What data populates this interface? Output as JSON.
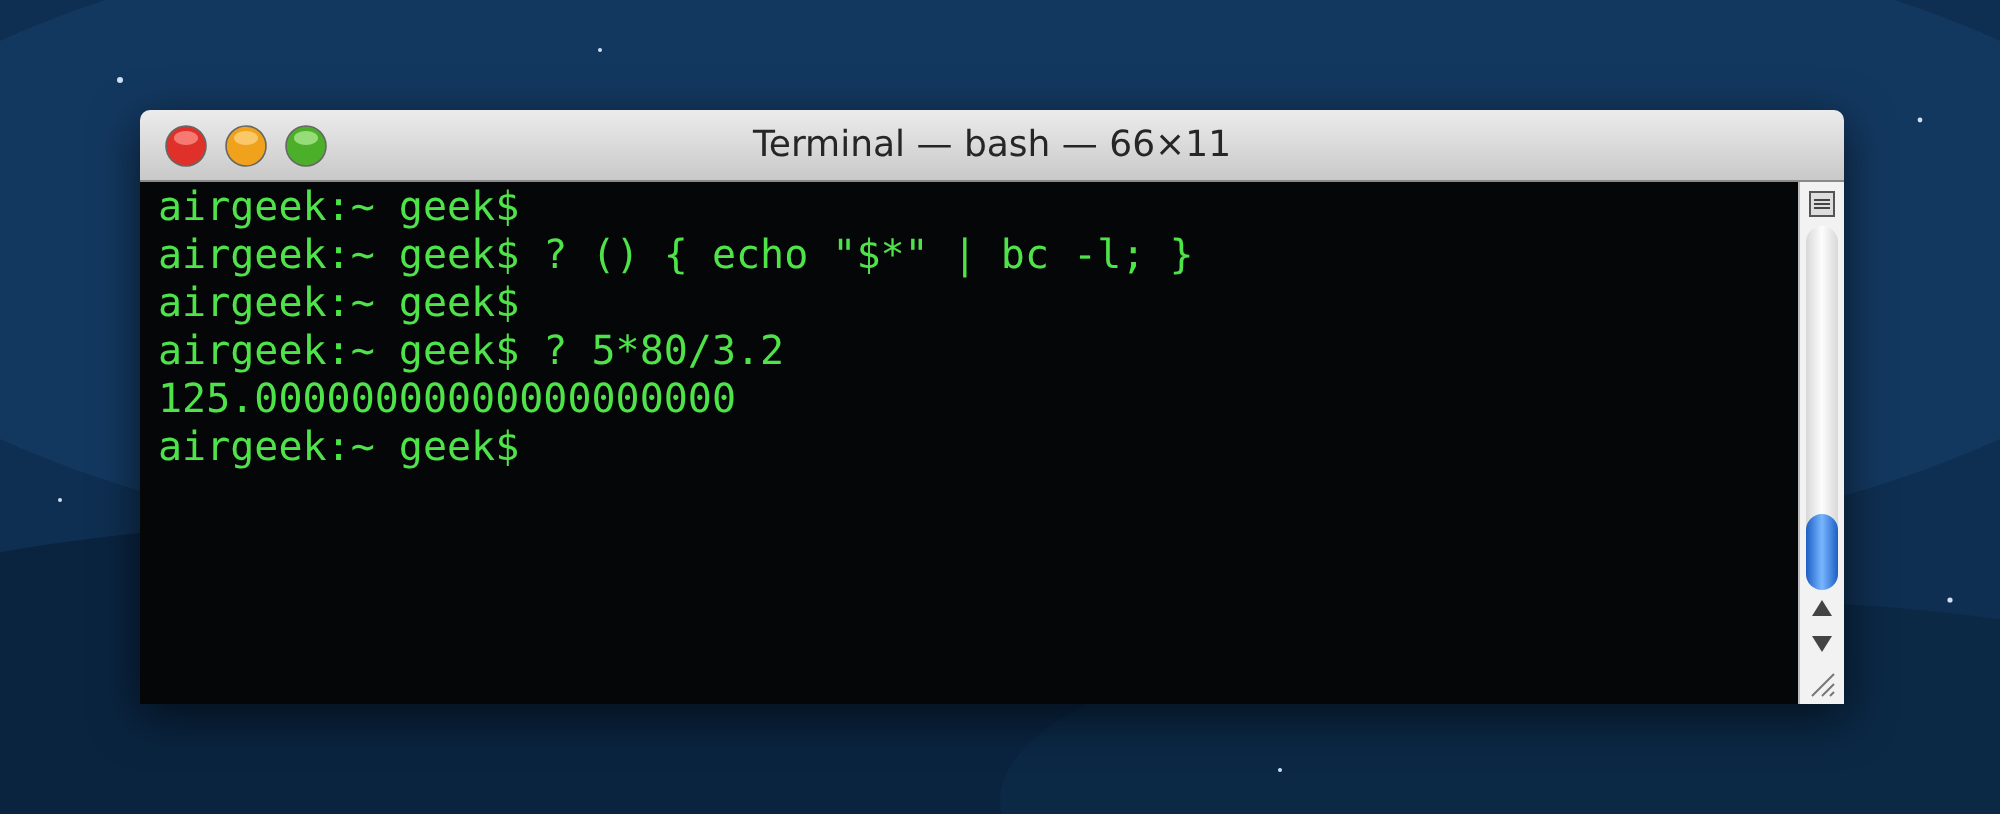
{
  "window": {
    "title": "Terminal — bash — 66×11"
  },
  "lines": [
    "airgeek:~ geek$",
    "airgeek:~ geek$ ? () { echo \"$*\" | bc -l; }",
    "airgeek:~ geek$",
    "airgeek:~ geek$ ? 5*80/3.2",
    "125.00000000000000000000",
    "airgeek:~ geek$"
  ]
}
